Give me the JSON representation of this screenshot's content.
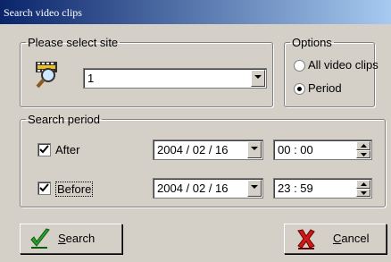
{
  "window": {
    "title": "Search video clips"
  },
  "site_group": {
    "legend": "Please select site",
    "site_value": "1"
  },
  "options_group": {
    "legend": "Options",
    "options": [
      {
        "label": "All video clips",
        "selected": false
      },
      {
        "label": "Period",
        "selected": true
      }
    ]
  },
  "period_group": {
    "legend": "Search period",
    "after": {
      "label": "After",
      "checked": true,
      "date": "2004 / 02 / 16",
      "time": "00 : 00"
    },
    "before": {
      "label": "Before",
      "checked": true,
      "date": "2004 / 02 / 16",
      "time": "23 : 59"
    }
  },
  "buttons": {
    "search": {
      "underlined_char": "S",
      "rest": "earch"
    },
    "cancel": {
      "underlined_char": "C",
      "rest": "ancel"
    }
  },
  "icons": {
    "site_search": "film-magnifier-icon",
    "search_button": "green-checkmark-icon",
    "cancel_button": "red-x-icon"
  },
  "colors": {
    "titlebar_start": "#0a246a",
    "titlebar_end": "#a6caf0",
    "dialog_bg": "#d4d0c8"
  }
}
